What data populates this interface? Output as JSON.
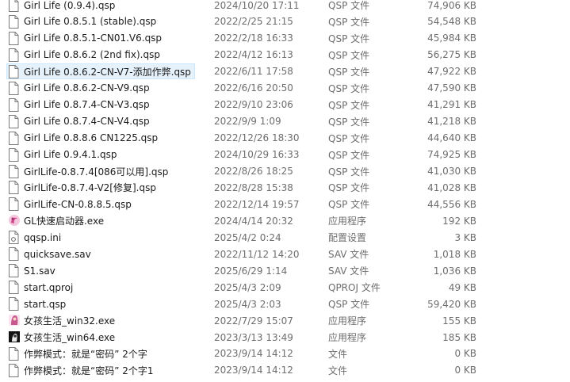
{
  "files": [
    {
      "name": "Girl Life (0.9.4).qsp",
      "date": "2024/10/20 17:11",
      "type": "QSP 文件",
      "size": "74,906 KB",
      "icon": "document-icon"
    },
    {
      "name": "Girl Life 0.8.5.1 (stable).qsp",
      "date": "2022/2/25 21:15",
      "type": "QSP 文件",
      "size": "54,548 KB",
      "icon": "document-icon"
    },
    {
      "name": "Girl Life 0.8.5.1-CN01.V6.qsp",
      "date": "2022/2/18 16:33",
      "type": "QSP 文件",
      "size": "45,984 KB",
      "icon": "document-icon"
    },
    {
      "name": "Girl Life 0.8.6.2 (2nd fix).qsp",
      "date": "2022/4/12 16:13",
      "type": "QSP 文件",
      "size": "56,275 KB",
      "icon": "document-icon"
    },
    {
      "name": "Girl Life 0.8.6.2-CN-V7-添加作弊.qsp",
      "date": "2022/6/11 17:58",
      "type": "QSP 文件",
      "size": "47,922 KB",
      "icon": "document-icon",
      "selected": true
    },
    {
      "name": "Girl Life 0.8.6.2-CN-V9.qsp",
      "date": "2022/6/16 20:50",
      "type": "QSP 文件",
      "size": "47,590 KB",
      "icon": "document-icon"
    },
    {
      "name": "Girl Life 0.8.7.4-CN-V3.qsp",
      "date": "2022/9/10 23:06",
      "type": "QSP 文件",
      "size": "41,291 KB",
      "icon": "document-icon"
    },
    {
      "name": "Girl Life 0.8.7.4-CN-V4.qsp",
      "date": "2022/9/9 1:09",
      "type": "QSP 文件",
      "size": "41,218 KB",
      "icon": "document-icon"
    },
    {
      "name": "Girl Life 0.8.8.6 CN1225.qsp",
      "date": "2022/12/26 18:30",
      "type": "QSP 文件",
      "size": "44,640 KB",
      "icon": "document-icon"
    },
    {
      "name": "Girl Life 0.9.4.1.qsp",
      "date": "2024/10/29 16:33",
      "type": "QSP 文件",
      "size": "74,925 KB",
      "icon": "document-icon"
    },
    {
      "name": "GirlLife-0.8.7.4[086可以用].qsp",
      "date": "2022/8/26 18:25",
      "type": "QSP 文件",
      "size": "41,030 KB",
      "icon": "document-icon"
    },
    {
      "name": "GirlLife-0.8.7.4-V2[修复].qsp",
      "date": "2022/8/28 15:38",
      "type": "QSP 文件",
      "size": "41,028 KB",
      "icon": "document-icon"
    },
    {
      "name": "GirlLife-CN-0.8.8.5.qsp",
      "date": "2022/12/14 19:57",
      "type": "QSP 文件",
      "size": "44,556 KB",
      "icon": "document-icon"
    },
    {
      "name": "GL快速启动器.exe",
      "date": "2024/4/14 20:32",
      "type": "应用程序",
      "size": "192 KB",
      "icon": "app-pink-icon"
    },
    {
      "name": "qqsp.ini",
      "date": "2025/4/2 0:24",
      "type": "配置设置",
      "size": "3 KB",
      "icon": "settings-file-icon"
    },
    {
      "name": "quicksave.sav",
      "date": "2022/11/12 14:20",
      "type": "SAV 文件",
      "size": "1,018 KB",
      "icon": "document-icon"
    },
    {
      "name": "S1.sav",
      "date": "2025/6/29 1:14",
      "type": "SAV 文件",
      "size": "1,036 KB",
      "icon": "document-icon"
    },
    {
      "name": "start.qproj",
      "date": "2025/4/3 2:09",
      "type": "QPROJ 文件",
      "size": "49 KB",
      "icon": "document-icon"
    },
    {
      "name": "start.qsp",
      "date": "2025/4/3 2:03",
      "type": "QSP 文件",
      "size": "59,420 KB",
      "icon": "document-icon"
    },
    {
      "name": "女孩生活_win32.exe",
      "date": "2022/7/29 15:07",
      "type": "应用程序",
      "size": "155 KB",
      "icon": "app-girl-icon"
    },
    {
      "name": "女孩生活_win64.exe",
      "date": "2023/3/13 13:49",
      "type": "应用程序",
      "size": "185 KB",
      "icon": "app-dark-icon"
    },
    {
      "name": "作弊模式：就是“密码” 2个字",
      "date": "2023/9/14 14:12",
      "type": "文件",
      "size": "0 KB",
      "icon": "document-icon"
    },
    {
      "name": "作弊模式：就是“密码” 2个字1",
      "date": "2023/9/14 14:12",
      "type": "文件",
      "size": "0 KB",
      "icon": "document-icon"
    }
  ],
  "colors": {
    "selection_bg": "#e5f1fb",
    "selection_border": "#cce8ff",
    "type_text": "#6d6d6d"
  }
}
